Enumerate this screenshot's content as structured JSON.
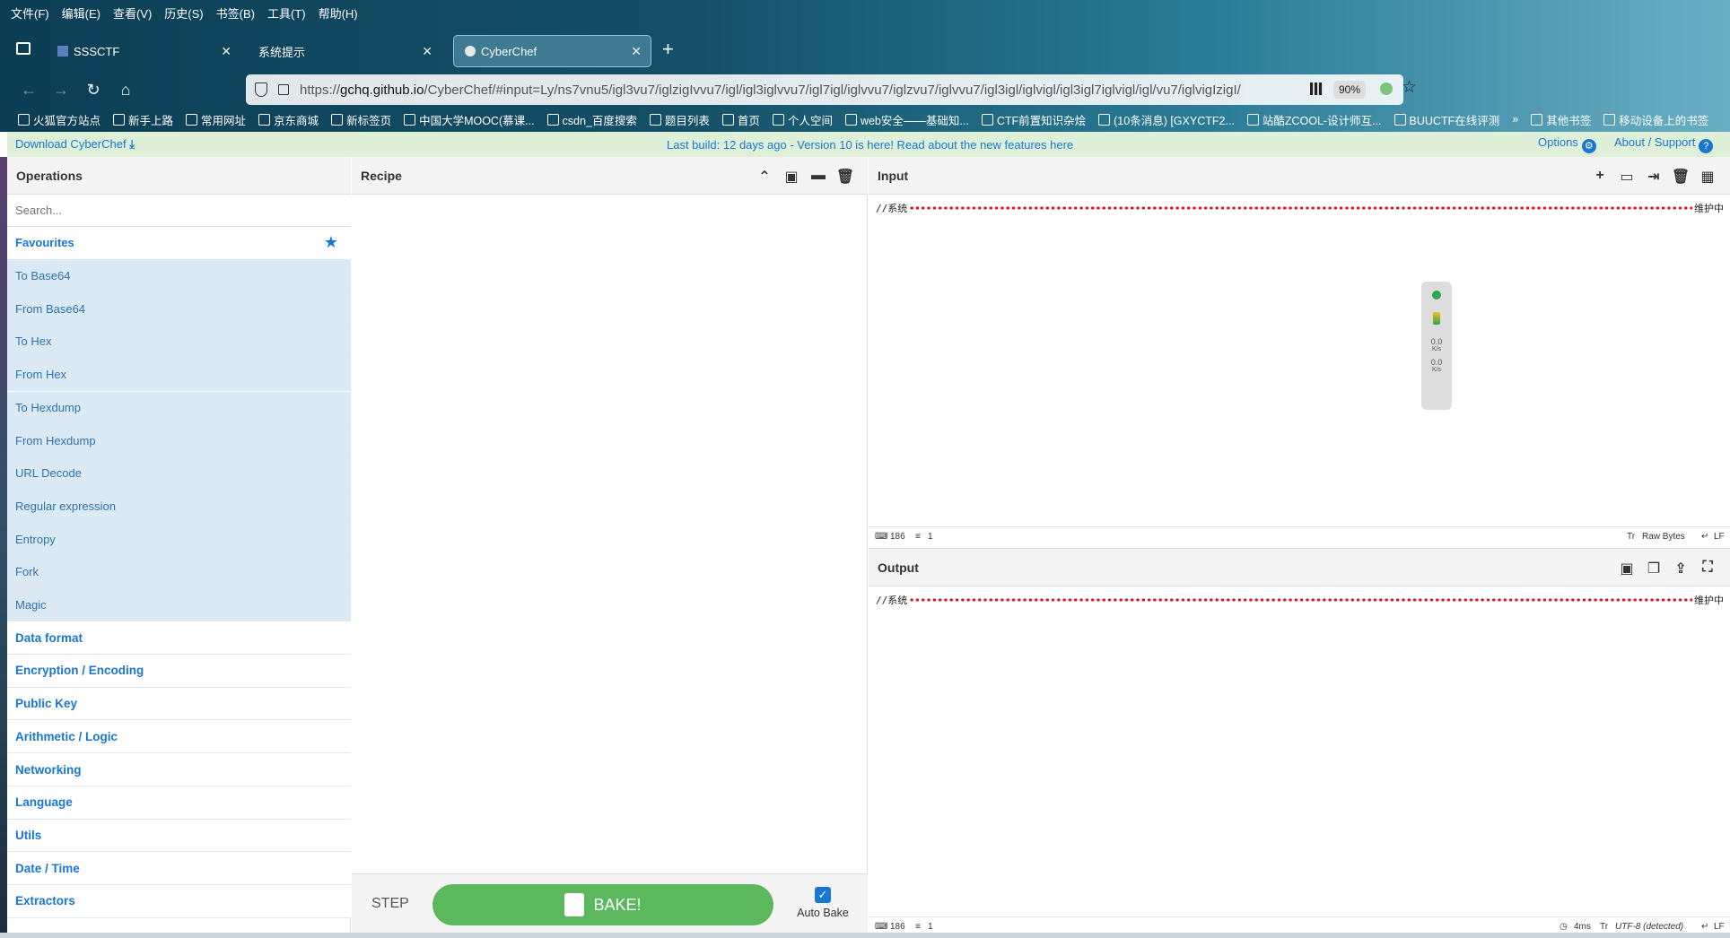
{
  "browser": {
    "menu": [
      "文件(F)",
      "编辑(E)",
      "查看(V)",
      "历史(S)",
      "书签(B)",
      "工具(T)",
      "帮助(H)"
    ],
    "tabs": [
      {
        "label": "SSSCTF",
        "active": false
      },
      {
        "label": "系统提示",
        "active": false
      },
      {
        "label": "CyberChef",
        "active": true
      }
    ],
    "url_prefix": "https://",
    "url_host": "gchq.github.io",
    "url_rest": "/CyberChef/#input=Ly/ns7vnu5/igl3vu7/iglzigIvvu7/igl/igl3iglvvu7/igl7igl/iglvvu7/iglzvu7/iglvvu7/igl3igl/iglvigl/igl3igl7iglvigl/igl/vu7/iglvigIzigI/",
    "zoom": "90%",
    "bookmarks": [
      "火狐官方站点",
      "新手上路",
      "常用网址",
      "京东商城",
      "新标签页",
      "中国大学MOOC(慕课...",
      "csdn_百度搜索",
      "题目列表",
      "首页",
      "个人空间",
      "web安全——基础知...",
      "CTF前置知识杂烩",
      "(10条消息) [GXYCTF2...",
      "站酷ZCOOL-设计师互...",
      "BUUCTF在线评测",
      "其他书签",
      "移动设备上的书签"
    ]
  },
  "banner": {
    "download": "Download CyberChef",
    "center": "Last build: 12 days ago - Version 10 is here! Read about the new features here",
    "options": "Options",
    "about": "About / Support"
  },
  "operations": {
    "title": "Operations",
    "search_placeholder": "Search...",
    "favourites_label": "Favourites",
    "favourites": [
      "To Base64",
      "From Base64",
      "To Hex",
      "From Hex",
      "To Hexdump",
      "From Hexdump",
      "URL Decode",
      "Regular expression",
      "Entropy",
      "Fork",
      "Magic"
    ],
    "categories": [
      "Data format",
      "Encryption / Encoding",
      "Public Key",
      "Arithmetic / Logic",
      "Networking",
      "Language",
      "Utils",
      "Date / Time",
      "Extractors"
    ]
  },
  "recipe": {
    "title": "Recipe",
    "step": "STEP",
    "bake": "BAKE!",
    "auto_bake": "Auto Bake",
    "auto_bake_checked": true
  },
  "input": {
    "title": "Input",
    "text_prefix": "//系统",
    "text_suffix": "维护中",
    "length": "186",
    "lines": "1",
    "encoding": "Raw Bytes",
    "eol": "LF"
  },
  "output": {
    "title": "Output",
    "text_prefix": "//系统",
    "text_suffix": "维护中",
    "length": "186",
    "lines": "1",
    "time": "4ms",
    "encoding": "UTF-8 (detected)",
    "eol": "LF"
  },
  "widget": {
    "up": "0.0",
    "down": "0.0",
    "unit": "K/s"
  },
  "colors": {
    "accent": "#1976d2",
    "bake_green": "#5cb85c",
    "favourite_bg": "#dbe9f4",
    "banner_bg": "#dff0d8",
    "dot_red": "#e0141e"
  }
}
